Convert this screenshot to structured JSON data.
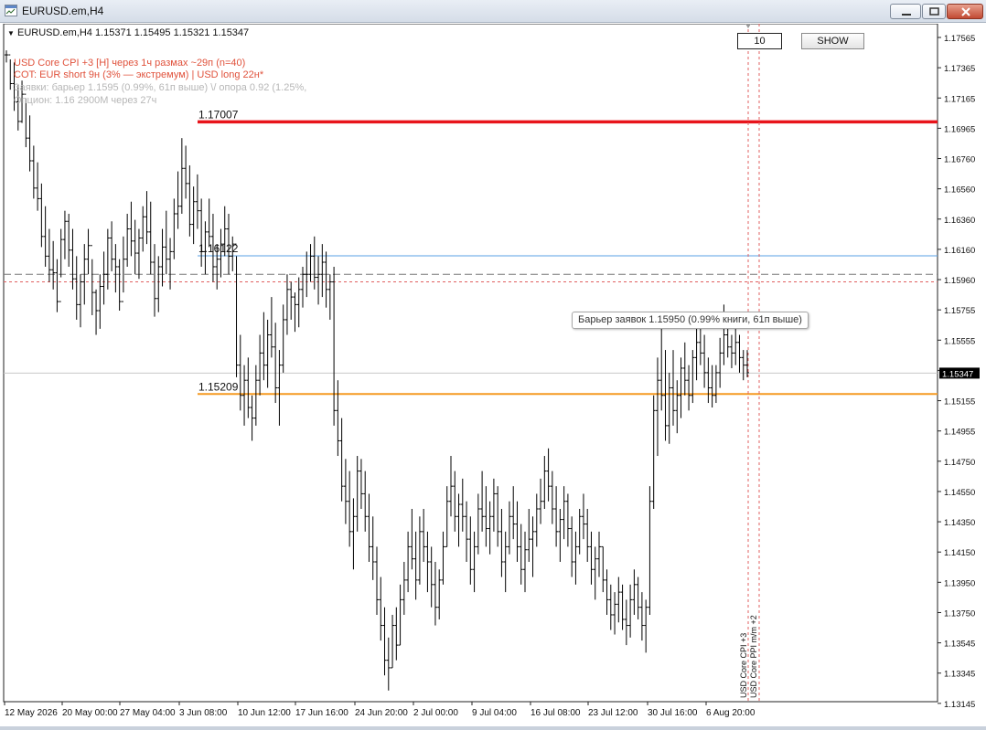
{
  "window": {
    "title": "EURUSD.em,H4"
  },
  "chart": {
    "header": "EURUSD.em,H4  1.15371 1.15495 1.15321 1.15347",
    "info_lines": [
      {
        "text": "USD Core CPI +3 [H] через 1ч  размах ~29п (n=40)",
        "color": "#e0523c"
      },
      {
        "text": "COT: EUR short 9н (3% — экстремум)  |  USD long 22н*",
        "color": "#e0523c"
      },
      {
        "text": "Заявки: барьер 1.1595 (0.99%, 61п выше)  \\/ опора 0.92 (1.25%,",
        "color": "#b7b7b7"
      },
      {
        "text": "Опцион: 1.16  2900M  через 27ч",
        "color": "#b7b7b7"
      }
    ],
    "input_value": "10",
    "show_button": "SHOW",
    "tooltip": "Барьер заявок 1.15950  (0.99% книги, 61п выше)",
    "current_price": "1.15347",
    "levels": [
      {
        "label": "1.17007",
        "price": 1.17007,
        "color": "#e8141b"
      },
      {
        "label": "1.16122",
        "price": 1.16122,
        "color": "#5aa2e6"
      },
      {
        "label": "1.15209",
        "price": 1.15209,
        "color": "#f59a22"
      }
    ],
    "dashed_levels": [
      {
        "price": 1.16,
        "color": "#777777"
      },
      {
        "price": 1.1595,
        "color": "#e06060"
      }
    ],
    "event_labels": [
      "USD Core CPI +3",
      "USD Core PPI m/m +2"
    ],
    "x_axis_labels": [
      "12 May 2026",
      "20 May 00:00",
      "27 May 04:00",
      "3 Jun 08:00",
      "10 Jun 12:00",
      "17 Jun 16:00",
      "24 Jun 20:00",
      "2 Jul 00:00",
      "9 Jul 04:00",
      "16 Jul 08:00",
      "23 Jul 12:00",
      "30 Jul 16:00",
      "6 Aug 20:00"
    ],
    "y_axis_labels": [
      "1.17565",
      "1.17365",
      "1.17165",
      "1.16965",
      "1.16760",
      "1.16560",
      "1.16360",
      "1.16160",
      "1.15960",
      "1.15755",
      "1.15555",
      "1.15355",
      "1.15155",
      "1.14955",
      "1.14750",
      "1.14550",
      "1.14350",
      "1.14150",
      "1.13950",
      "1.13750",
      "1.13545",
      "1.13345",
      "1.13145"
    ],
    "bars": [
      [
        1.1748,
        1.174,
        1.1745
      ],
      [
        1.1742,
        1.1722,
        1.1726
      ],
      [
        1.174,
        1.1708,
        1.1714
      ],
      [
        1.1725,
        1.1695,
        1.1701
      ],
      [
        1.1728,
        1.17,
        1.1719
      ],
      [
        1.1716,
        1.1684,
        1.169
      ],
      [
        1.1705,
        1.1668,
        1.1675
      ],
      [
        1.1685,
        1.165,
        1.1657
      ],
      [
        1.1674,
        1.1642,
        1.165
      ],
      [
        1.166,
        1.1618,
        1.1625
      ],
      [
        1.1645,
        1.1605,
        1.1612
      ],
      [
        1.163,
        1.1595,
        1.1603
      ],
      [
        1.1622,
        1.159,
        1.1601
      ],
      [
        1.161,
        1.1575,
        1.1582
      ],
      [
        1.163,
        1.1598,
        1.1623
      ],
      [
        1.1642,
        1.161,
        1.1635
      ],
      [
        1.164,
        1.1605,
        1.1616
      ],
      [
        1.163,
        1.159,
        1.1597
      ],
      [
        1.1612,
        1.157,
        1.158
      ],
      [
        1.16,
        1.1565,
        1.1595
      ],
      [
        1.162,
        1.158,
        1.161
      ],
      [
        1.163,
        1.16,
        1.1619
      ],
      [
        1.161,
        1.1573,
        1.1588
      ],
      [
        1.159,
        1.156,
        1.1576
      ],
      [
        1.16,
        1.1564,
        1.1592
      ],
      [
        1.1615,
        1.158,
        1.16
      ],
      [
        1.163,
        1.159,
        1.1624
      ],
      [
        1.1635,
        1.1602,
        1.161
      ],
      [
        1.162,
        1.1588,
        1.1605
      ],
      [
        1.161,
        1.1576,
        1.1582
      ],
      [
        1.1625,
        1.1588,
        1.161
      ],
      [
        1.164,
        1.1605,
        1.163
      ],
      [
        1.1648,
        1.1612,
        1.1622
      ],
      [
        1.1636,
        1.16,
        1.1614
      ],
      [
        1.163,
        1.1597,
        1.1624
      ],
      [
        1.1645,
        1.1615,
        1.1638
      ],
      [
        1.1655,
        1.162,
        1.1628
      ],
      [
        1.1648,
        1.16,
        1.1608
      ],
      [
        1.162,
        1.1572,
        1.1584
      ],
      [
        1.1612,
        1.1575,
        1.1605
      ],
      [
        1.163,
        1.1592,
        1.1618
      ],
      [
        1.1642,
        1.16,
        1.161
      ],
      [
        1.1624,
        1.159,
        1.1615
      ],
      [
        1.165,
        1.161,
        1.164
      ],
      [
        1.1668,
        1.163,
        1.1645
      ],
      [
        1.169,
        1.164,
        1.167
      ],
      [
        1.1685,
        1.165,
        1.166
      ],
      [
        1.1672,
        1.1625,
        1.1633
      ],
      [
        1.1658,
        1.162,
        1.1648
      ],
      [
        1.1666,
        1.163,
        1.1642
      ],
      [
        1.165,
        1.1605,
        1.1615
      ],
      [
        1.1635,
        1.16,
        1.1628
      ],
      [
        1.165,
        1.1618,
        1.1625
      ],
      [
        1.164,
        1.1595,
        1.1605
      ],
      [
        1.162,
        1.159,
        1.161
      ],
      [
        1.163,
        1.1598,
        1.162
      ],
      [
        1.1645,
        1.1612,
        1.163
      ],
      [
        1.164,
        1.16,
        1.1612
      ],
      [
        1.1625,
        1.1602,
        1.162
      ],
      [
        1.1612,
        1.1532,
        1.154
      ],
      [
        1.156,
        1.151,
        1.152
      ],
      [
        1.154,
        1.15,
        1.153
      ],
      [
        1.1545,
        1.1505,
        1.1512
      ],
      [
        1.152,
        1.149,
        1.1505
      ],
      [
        1.154,
        1.15,
        1.153
      ],
      [
        1.156,
        1.152,
        1.1548
      ],
      [
        1.1575,
        1.153,
        1.154
      ],
      [
        1.157,
        1.1525,
        1.156
      ],
      [
        1.1585,
        1.1545,
        1.1552
      ],
      [
        1.1568,
        1.1515,
        1.1525
      ],
      [
        1.155,
        1.15,
        1.154
      ],
      [
        1.158,
        1.1535,
        1.157
      ],
      [
        1.16,
        1.156,
        1.159
      ],
      [
        1.1595,
        1.157,
        1.1585
      ],
      [
        1.1588,
        1.1562,
        1.158
      ],
      [
        1.1598,
        1.1565,
        1.159
      ],
      [
        1.1605,
        1.1578,
        1.16
      ],
      [
        1.1615,
        1.1585,
        1.16
      ],
      [
        1.162,
        1.1595,
        1.1612
      ],
      [
        1.1625,
        1.159,
        1.1598
      ],
      [
        1.1612,
        1.158,
        1.16
      ],
      [
        1.162,
        1.1585,
        1.1608
      ],
      [
        1.1615,
        1.1578,
        1.159
      ],
      [
        1.16,
        1.157,
        1.1595
      ],
      [
        1.1605,
        1.15,
        1.151
      ],
      [
        1.153,
        1.148,
        1.149
      ],
      [
        1.1505,
        1.145,
        1.146
      ],
      [
        1.1478,
        1.1435,
        1.145
      ],
      [
        1.147,
        1.142,
        1.143
      ],
      [
        1.1452,
        1.1405,
        1.144
      ],
      [
        1.148,
        1.143,
        1.147
      ],
      [
        1.1478,
        1.1445,
        1.1455
      ],
      [
        1.147,
        1.143,
        1.144
      ],
      [
        1.1455,
        1.141,
        1.142
      ],
      [
        1.144,
        1.1398,
        1.141
      ],
      [
        1.142,
        1.1375,
        1.1385
      ],
      [
        1.14,
        1.1358,
        1.1368
      ],
      [
        1.138,
        1.1335,
        1.1345
      ],
      [
        1.136,
        1.1325,
        1.134
      ],
      [
        1.1375,
        1.134,
        1.1368
      ],
      [
        1.138,
        1.1345,
        1.1355
      ],
      [
        1.1395,
        1.1355,
        1.1385
      ],
      [
        1.141,
        1.1375,
        1.1398
      ],
      [
        1.143,
        1.139,
        1.142
      ],
      [
        1.1445,
        1.1405,
        1.1412
      ],
      [
        1.143,
        1.1385,
        1.1398
      ],
      [
        1.144,
        1.1395,
        1.143
      ],
      [
        1.1445,
        1.141,
        1.142
      ],
      [
        1.143,
        1.139,
        1.141
      ],
      [
        1.142,
        1.138,
        1.1395
      ],
      [
        1.141,
        1.1368,
        1.138
      ],
      [
        1.1405,
        1.1372,
        1.1398
      ],
      [
        1.143,
        1.1395,
        1.142
      ],
      [
        1.146,
        1.142,
        1.145
      ],
      [
        1.148,
        1.144,
        1.146
      ],
      [
        1.147,
        1.143,
        1.144
      ],
      [
        1.1455,
        1.142,
        1.1448
      ],
      [
        1.1465,
        1.143,
        1.144
      ],
      [
        1.145,
        1.141,
        1.1425
      ],
      [
        1.144,
        1.1395,
        1.1405
      ],
      [
        1.143,
        1.139,
        1.142
      ],
      [
        1.1455,
        1.1415,
        1.1445
      ],
      [
        1.147,
        1.143,
        1.144
      ],
      [
        1.146,
        1.142,
        1.1432
      ],
      [
        1.145,
        1.1415,
        1.144
      ],
      [
        1.1465,
        1.143,
        1.1455
      ],
      [
        1.146,
        1.142,
        1.143
      ],
      [
        1.1445,
        1.14,
        1.141
      ],
      [
        1.143,
        1.139,
        1.142
      ],
      [
        1.145,
        1.1415,
        1.144
      ],
      [
        1.146,
        1.1425,
        1.1435
      ],
      [
        1.145,
        1.141,
        1.142
      ],
      [
        1.1435,
        1.1395,
        1.1405
      ],
      [
        1.143,
        1.139,
        1.1418
      ],
      [
        1.1445,
        1.141,
        1.1425
      ],
      [
        1.144,
        1.14,
        1.143
      ],
      [
        1.1455,
        1.142,
        1.1445
      ],
      [
        1.1465,
        1.1435,
        1.145
      ],
      [
        1.148,
        1.1445,
        1.147
      ],
      [
        1.1485,
        1.145,
        1.146
      ],
      [
        1.147,
        1.1435,
        1.1445
      ],
      [
        1.146,
        1.142,
        1.143
      ],
      [
        1.1445,
        1.141,
        1.1438
      ],
      [
        1.146,
        1.1425,
        1.145
      ],
      [
        1.1455,
        1.142,
        1.1432
      ],
      [
        1.144,
        1.14,
        1.141
      ],
      [
        1.143,
        1.1395,
        1.142
      ],
      [
        1.1445,
        1.1415,
        1.144
      ],
      [
        1.1455,
        1.1425,
        1.1435
      ],
      [
        1.1445,
        1.141,
        1.142
      ],
      [
        1.143,
        1.1395,
        1.1405
      ],
      [
        1.142,
        1.1385,
        1.1412
      ],
      [
        1.143,
        1.14,
        1.142
      ],
      [
        1.142,
        1.139,
        1.1398
      ],
      [
        1.1405,
        1.1375,
        1.1385
      ],
      [
        1.1395,
        1.1365,
        1.1375
      ],
      [
        1.139,
        1.1362,
        1.1382
      ],
      [
        1.14,
        1.137,
        1.139
      ],
      [
        1.1395,
        1.1365,
        1.1372
      ],
      [
        1.1385,
        1.1355,
        1.1368
      ],
      [
        1.1395,
        1.136,
        1.1385
      ],
      [
        1.1405,
        1.1375,
        1.1395
      ],
      [
        1.14,
        1.1372,
        1.138
      ],
      [
        1.139,
        1.1358,
        1.1368
      ],
      [
        1.1385,
        1.135,
        1.138
      ],
      [
        1.146,
        1.1375,
        1.145
      ],
      [
        1.152,
        1.1445,
        1.151
      ],
      [
        1.1545,
        1.148,
        1.153
      ],
      [
        1.1565,
        1.151,
        1.152
      ],
      [
        1.155,
        1.149,
        1.15
      ],
      [
        1.1535,
        1.1488,
        1.1525
      ],
      [
        1.155,
        1.15,
        1.151
      ],
      [
        1.153,
        1.1495,
        1.152
      ],
      [
        1.1545,
        1.1505,
        1.1538
      ],
      [
        1.1555,
        1.152,
        1.153
      ],
      [
        1.154,
        1.151,
        1.152
      ],
      [
        1.155,
        1.1515,
        1.1545
      ],
      [
        1.1565,
        1.153,
        1.1555
      ],
      [
        1.157,
        1.154,
        1.1548
      ],
      [
        1.156,
        1.1525,
        1.1535
      ],
      [
        1.1545,
        1.1515,
        1.1525
      ],
      [
        1.154,
        1.1512,
        1.152
      ],
      [
        1.154,
        1.1515,
        1.1535
      ],
      [
        1.1558,
        1.1525,
        1.1548
      ],
      [
        1.158,
        1.154,
        1.156
      ],
      [
        1.157,
        1.1545,
        1.1552
      ],
      [
        1.156,
        1.1538,
        1.1548
      ],
      [
        1.1565,
        1.154,
        1.1555
      ],
      [
        1.156,
        1.1535,
        1.1545
      ],
      [
        1.155,
        1.153,
        1.154
      ],
      [
        1.155,
        1.1532,
        1.1535
      ]
    ]
  }
}
